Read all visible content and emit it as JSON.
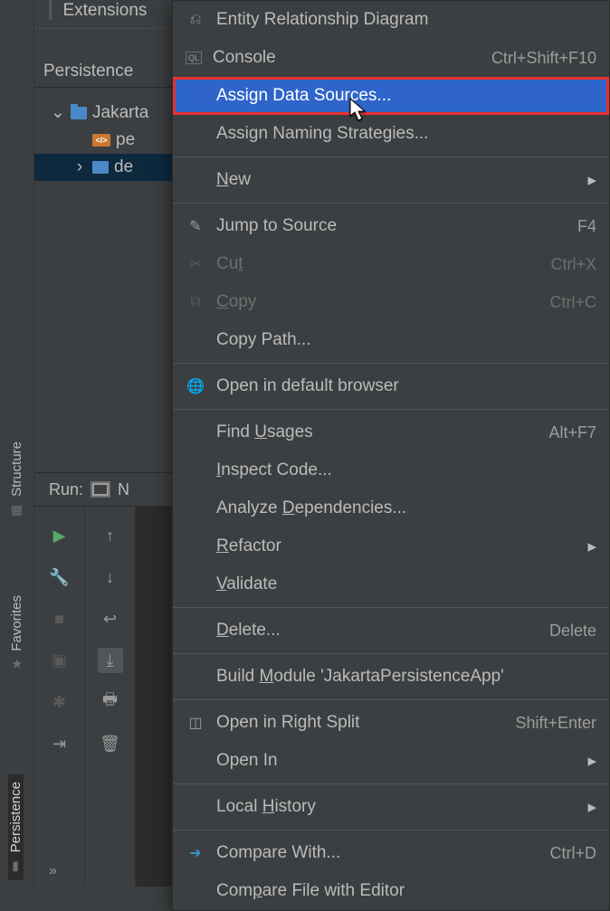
{
  "extensions_label": "Extensions",
  "sidebar": {
    "structure": "Structure",
    "favorites": "Favorites",
    "persistence": "Persistence"
  },
  "persistence_panel": {
    "title": "Persistence",
    "items": {
      "root": "Jakarta",
      "pe": "pe",
      "de": "de"
    }
  },
  "run_label": "Run:",
  "run_tab_letter": "N",
  "context_menu": {
    "erd": "Entity Relationship Diagram",
    "console": "Console",
    "console_shortcut": "Ctrl+Shift+F10",
    "assign_ds": "Assign Data Sources...",
    "assign_naming": "Assign Naming Strategies...",
    "new": "New",
    "jump_source": "Jump to Source",
    "jump_shortcut": "F4",
    "cut": "Cut",
    "cut_shortcut": "Ctrl+X",
    "copy": "Copy",
    "copy_shortcut": "Ctrl+C",
    "copy_path": "Copy Path...",
    "open_browser": "Open in default browser",
    "find_usages": "Find Usages",
    "find_usages_shortcut": "Alt+F7",
    "inspect_code": "Inspect Code...",
    "analyze_deps": "Analyze Dependencies...",
    "refactor": "Refactor",
    "validate": "Validate",
    "delete": "Delete...",
    "delete_shortcut": "Delete",
    "build_module": "Build Module 'JakartaPersistenceApp'",
    "open_split": "Open in Right Split",
    "open_split_shortcut": "Shift+Enter",
    "open_in": "Open In",
    "local_history": "Local History",
    "compare_with": "Compare With...",
    "compare_shortcut": "Ctrl+D",
    "compare_editor": "Compare File with Editor"
  }
}
